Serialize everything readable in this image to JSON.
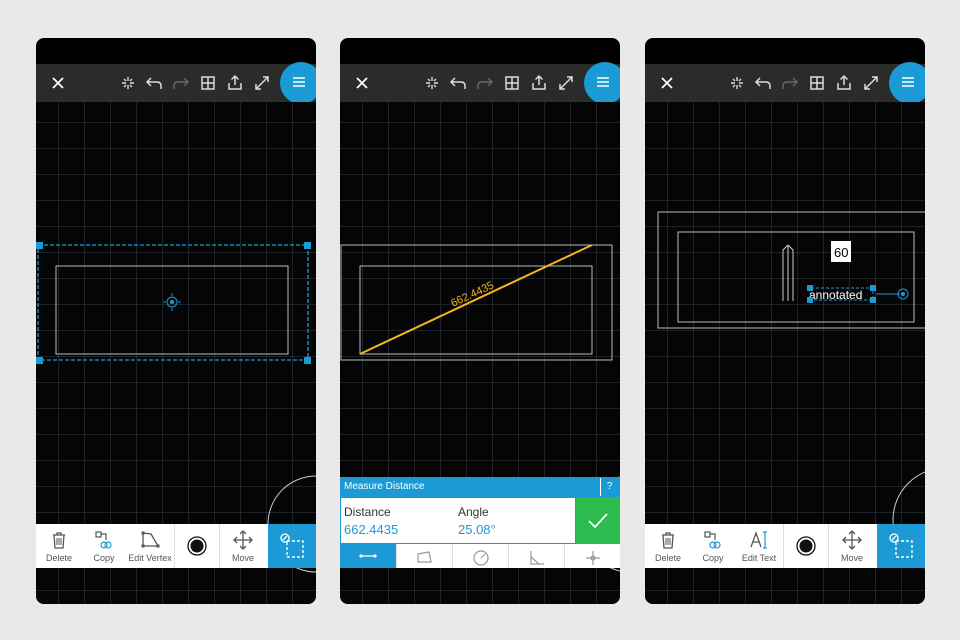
{
  "colors": {
    "accent": "#1c9ad6",
    "measure_line": "#f5b31c",
    "confirm": "#2bbb4f",
    "canvas": "#050505"
  },
  "topbar_icons": [
    "close-icon",
    "sparkle-icon",
    "undo-icon",
    "redo-icon",
    "grid-icon",
    "share-icon",
    "expand-icon",
    "hamburger-menu-icon"
  ],
  "screen1": {
    "toolbar": {
      "delete_label": "Delete",
      "copy_label": "Copy",
      "edit_vertex_label": "Edit Vertex",
      "move_label": "Move"
    }
  },
  "screen2": {
    "measure": {
      "title": "Measure Distance",
      "help": "?",
      "distance_label": "Distance",
      "distance_value": "662.4435",
      "angle_label": "Angle",
      "angle_value": "25.08°"
    },
    "dimension_text": "662.4435"
  },
  "screen3": {
    "annotation_number": "60",
    "annotation_text": "annotated",
    "toolbar": {
      "delete_label": "Delete",
      "copy_label": "Copy",
      "edit_text_label": "Edit Text",
      "move_label": "Move"
    }
  }
}
